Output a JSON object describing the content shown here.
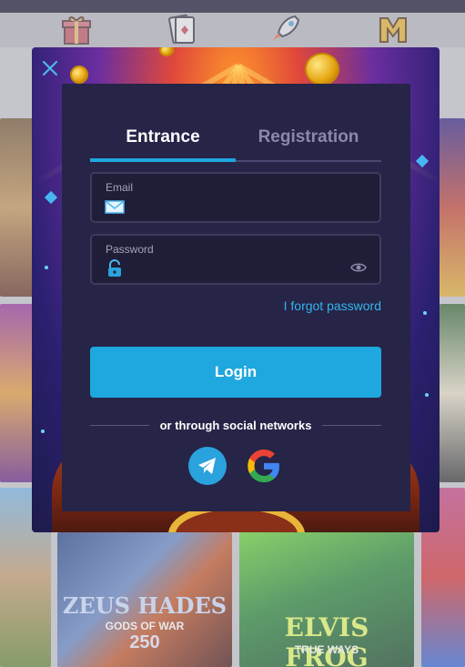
{
  "modal": {
    "tabs": [
      {
        "label": "Entrance",
        "active": true
      },
      {
        "label": "Registration",
        "active": false
      }
    ],
    "email": {
      "label": "Email",
      "value": ""
    },
    "password": {
      "label": "Password",
      "value": ""
    },
    "forgot_label": "I forgot password",
    "login_label": "Login",
    "social_label": "or through social networks",
    "social": [
      "telegram-icon",
      "google-icon"
    ]
  },
  "background_games": [
    {
      "title_line1": "ZEUS HADES",
      "title_line2": "GODS OF WAR",
      "title_line3": "250"
    },
    {
      "title_line1": "ELVIS FROG",
      "title_line2": "TRUE WAYS"
    }
  ],
  "colors": {
    "accent": "#1fa7df",
    "panel": "#262447",
    "field": "#1f1d38",
    "inactive_tab": "#8b89a6"
  },
  "nav_icons": [
    "gift-icon",
    "cards-icon",
    "rocket-icon",
    "m-badge-icon"
  ]
}
